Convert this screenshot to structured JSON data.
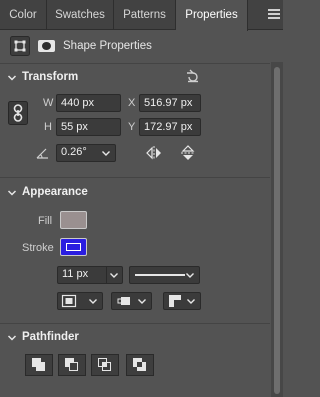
{
  "tabs": [
    {
      "label": "Color"
    },
    {
      "label": "Swatches"
    },
    {
      "label": "Patterns"
    },
    {
      "label": "Properties",
      "active": true
    }
  ],
  "header": {
    "label": "Shape Properties"
  },
  "transform": {
    "title": "Transform",
    "w_label": "W",
    "w_value": "440 px",
    "h_label": "H",
    "h_value": "55 px",
    "x_label": "X",
    "x_value": "516.97 px",
    "y_label": "Y",
    "y_value": "172.97 px",
    "angle_value": "0.26°"
  },
  "appearance": {
    "title": "Appearance",
    "fill_label": "Fill",
    "stroke_label": "Stroke",
    "stroke_width": "11 px",
    "fill_color": "#9a9090",
    "stroke_color": "#2a1de0"
  },
  "pathfinder": {
    "title": "Pathfinder"
  }
}
